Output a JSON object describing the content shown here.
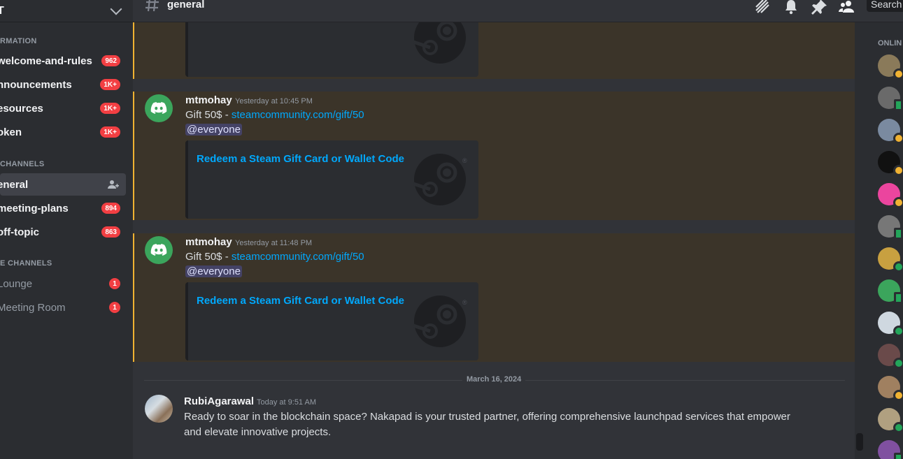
{
  "server": {
    "name": "T"
  },
  "sidebar": {
    "categories": [
      "RMATION",
      "CHANNELS",
      "E CHANNELS"
    ],
    "channels": [
      {
        "label": "welcome-and-rules",
        "badge": "962"
      },
      {
        "label": "nnouncements",
        "badge": "1K+"
      },
      {
        "label": "esources",
        "badge": "1K+"
      },
      {
        "label": "oken",
        "badge": "1K+"
      },
      {
        "label": "eneral",
        "badge": ""
      },
      {
        "label": "meeting-plans",
        "badge": "894"
      },
      {
        "label": "off-topic",
        "badge": "863"
      },
      {
        "label": "Lounge",
        "badge": "1"
      },
      {
        "label": "Meeting Room",
        "badge": "1"
      }
    ]
  },
  "header": {
    "channel_title": "general",
    "search_placeholder": "Search"
  },
  "messages": [
    {
      "author": "mtmohay",
      "timestamp": "Yesterday at 10:45 PM",
      "text_prefix": "Gift 50$ - ",
      "link": "steamcommunity.com/gift/50",
      "mention": "@everyone",
      "embed_title": "Redeem a Steam Gift Card or Wallet Code"
    },
    {
      "author": "mtmohay",
      "timestamp": "Yesterday at 11:48 PM",
      "text_prefix": "Gift 50$ - ",
      "link": "steamcommunity.com/gift/50",
      "mention": "@everyone",
      "embed_title": "Redeem a Steam Gift Card or Wallet Code"
    },
    {
      "author": "RubiAgarawal",
      "timestamp": "Today at 9:51 AM",
      "line1": "Ready to soar in the blockchain space? Nakapad is your trusted partner, offering comprehensive launchpad services that empower",
      "line2": "and elevate innovative projects."
    }
  ],
  "date_divider": "March 16, 2024",
  "members": {
    "label": "ONLIN",
    "statuses": [
      "idle",
      "mobile",
      "idle",
      "idle",
      "idle",
      "mobile",
      "online",
      "mobile",
      "online",
      "online",
      "idle",
      "online",
      "mobile"
    ],
    "colors": [
      "#8a7a5a",
      "#6a6a6a",
      "#7a8aa0",
      "#111111",
      "#eb459e",
      "#777777",
      "#c8a040",
      "#3ba55c",
      "#cfd8e0",
      "#6a4a4a",
      "#a08060",
      "#b0a080",
      "#8050a0"
    ]
  },
  "colors": {
    "accent_link": "#00a8fc",
    "mention_highlight": "#f0b232",
    "badge": "#f23f43",
    "online": "#23a55a",
    "idle": "#f0b232"
  }
}
